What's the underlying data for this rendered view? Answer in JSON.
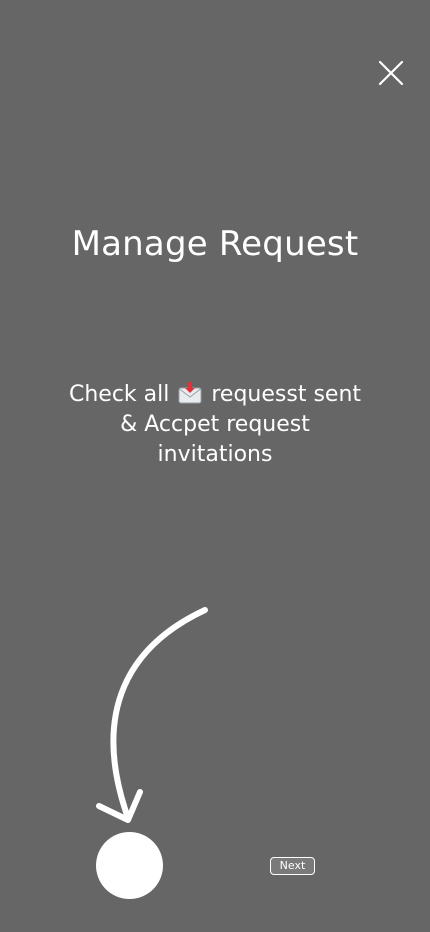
{
  "onboarding": {
    "title": "Manage Request",
    "description_before_icon": "Check all",
    "description_icon": "incoming-envelope-icon",
    "description_after_icon": "requesst sent & Accpet request invitations",
    "next_label": "Next"
  },
  "icons": {
    "close": "close-icon",
    "arrow": "curved-arrow-icon",
    "step_indicator": "circle-indicator"
  },
  "colors": {
    "background": "#666666",
    "foreground": "#ffffff"
  }
}
